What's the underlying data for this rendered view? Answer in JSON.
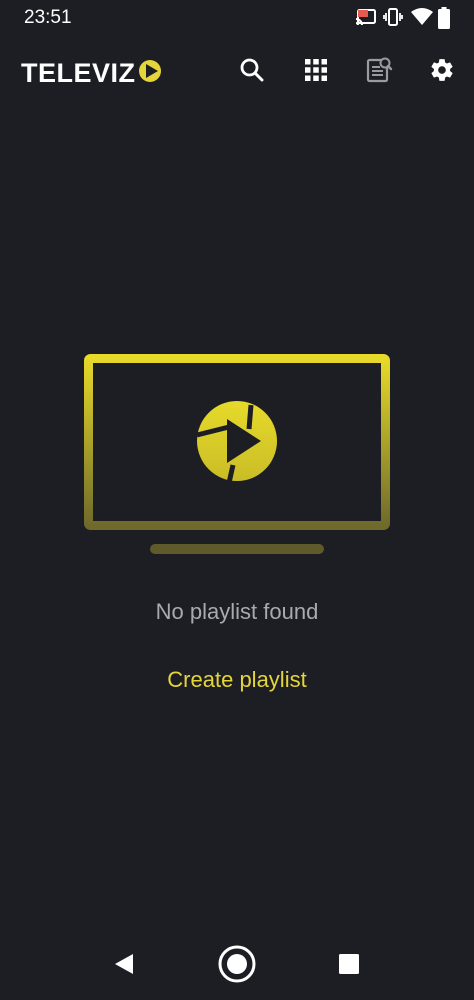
{
  "status_bar": {
    "time": "23:51",
    "icons": [
      "cast-icon",
      "vibrate-icon",
      "wifi-icon",
      "battery-icon"
    ]
  },
  "app_bar": {
    "logo_text": "TELEVIZ",
    "actions": [
      "search-icon",
      "grid-icon",
      "document-search-icon",
      "gear-icon"
    ]
  },
  "empty_state": {
    "illustration": "tv-play-icon",
    "message": "No playlist found",
    "action_label": "Create playlist"
  },
  "nav_bar": {
    "buttons": [
      "back-icon",
      "home-icon",
      "recents-icon"
    ]
  },
  "colors": {
    "background": "#1d1e24",
    "accent": "#e4d63a",
    "text_secondary": "#a9aab0",
    "icon": "#ffffff"
  }
}
